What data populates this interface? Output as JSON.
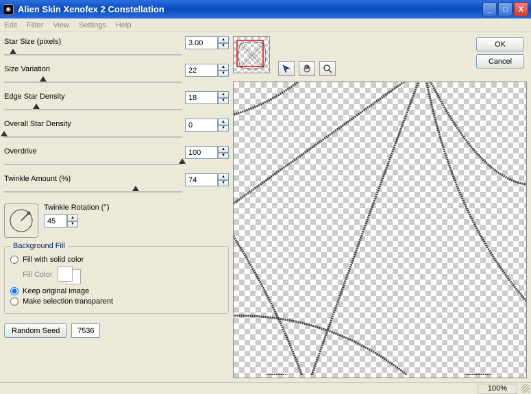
{
  "window": {
    "title": "Alien Skin Xenofex 2 Constellation",
    "minimize": "_",
    "maximize": "□",
    "close": "X"
  },
  "menu": {
    "edit": "Edit",
    "filter": "Filter",
    "view": "View",
    "settings": "Settings",
    "help": "Help"
  },
  "params": {
    "star_size": {
      "label": "Star Size (pixels)",
      "value": "3.00",
      "pos": 5
    },
    "size_var": {
      "label": "Size Variation",
      "value": "22",
      "pos": 22
    },
    "edge_dens": {
      "label": "Edge Star Density",
      "value": "18",
      "pos": 18
    },
    "overall": {
      "label": "Overall Star Density",
      "value": "0",
      "pos": 0
    },
    "overdrive": {
      "label": "Overdrive",
      "value": "100",
      "pos": 100
    },
    "twinkle_amt": {
      "label": "Twinkle Amount (%)",
      "value": "74",
      "pos": 74
    }
  },
  "twinkle_rot": {
    "label": "Twinkle Rotation (°)",
    "value": "45"
  },
  "bg": {
    "legend": "Background Fill",
    "opt_solid": "Fill with solid color",
    "fill_color_label": "Fill Color",
    "opt_keep": "Keep original image",
    "opt_trans": "Make selection transparent",
    "selected": "keep"
  },
  "seed": {
    "button": "Random Seed",
    "value": "7536"
  },
  "buttons": {
    "ok": "OK",
    "cancel": "Cancel"
  },
  "status": {
    "zoom": "100%"
  }
}
